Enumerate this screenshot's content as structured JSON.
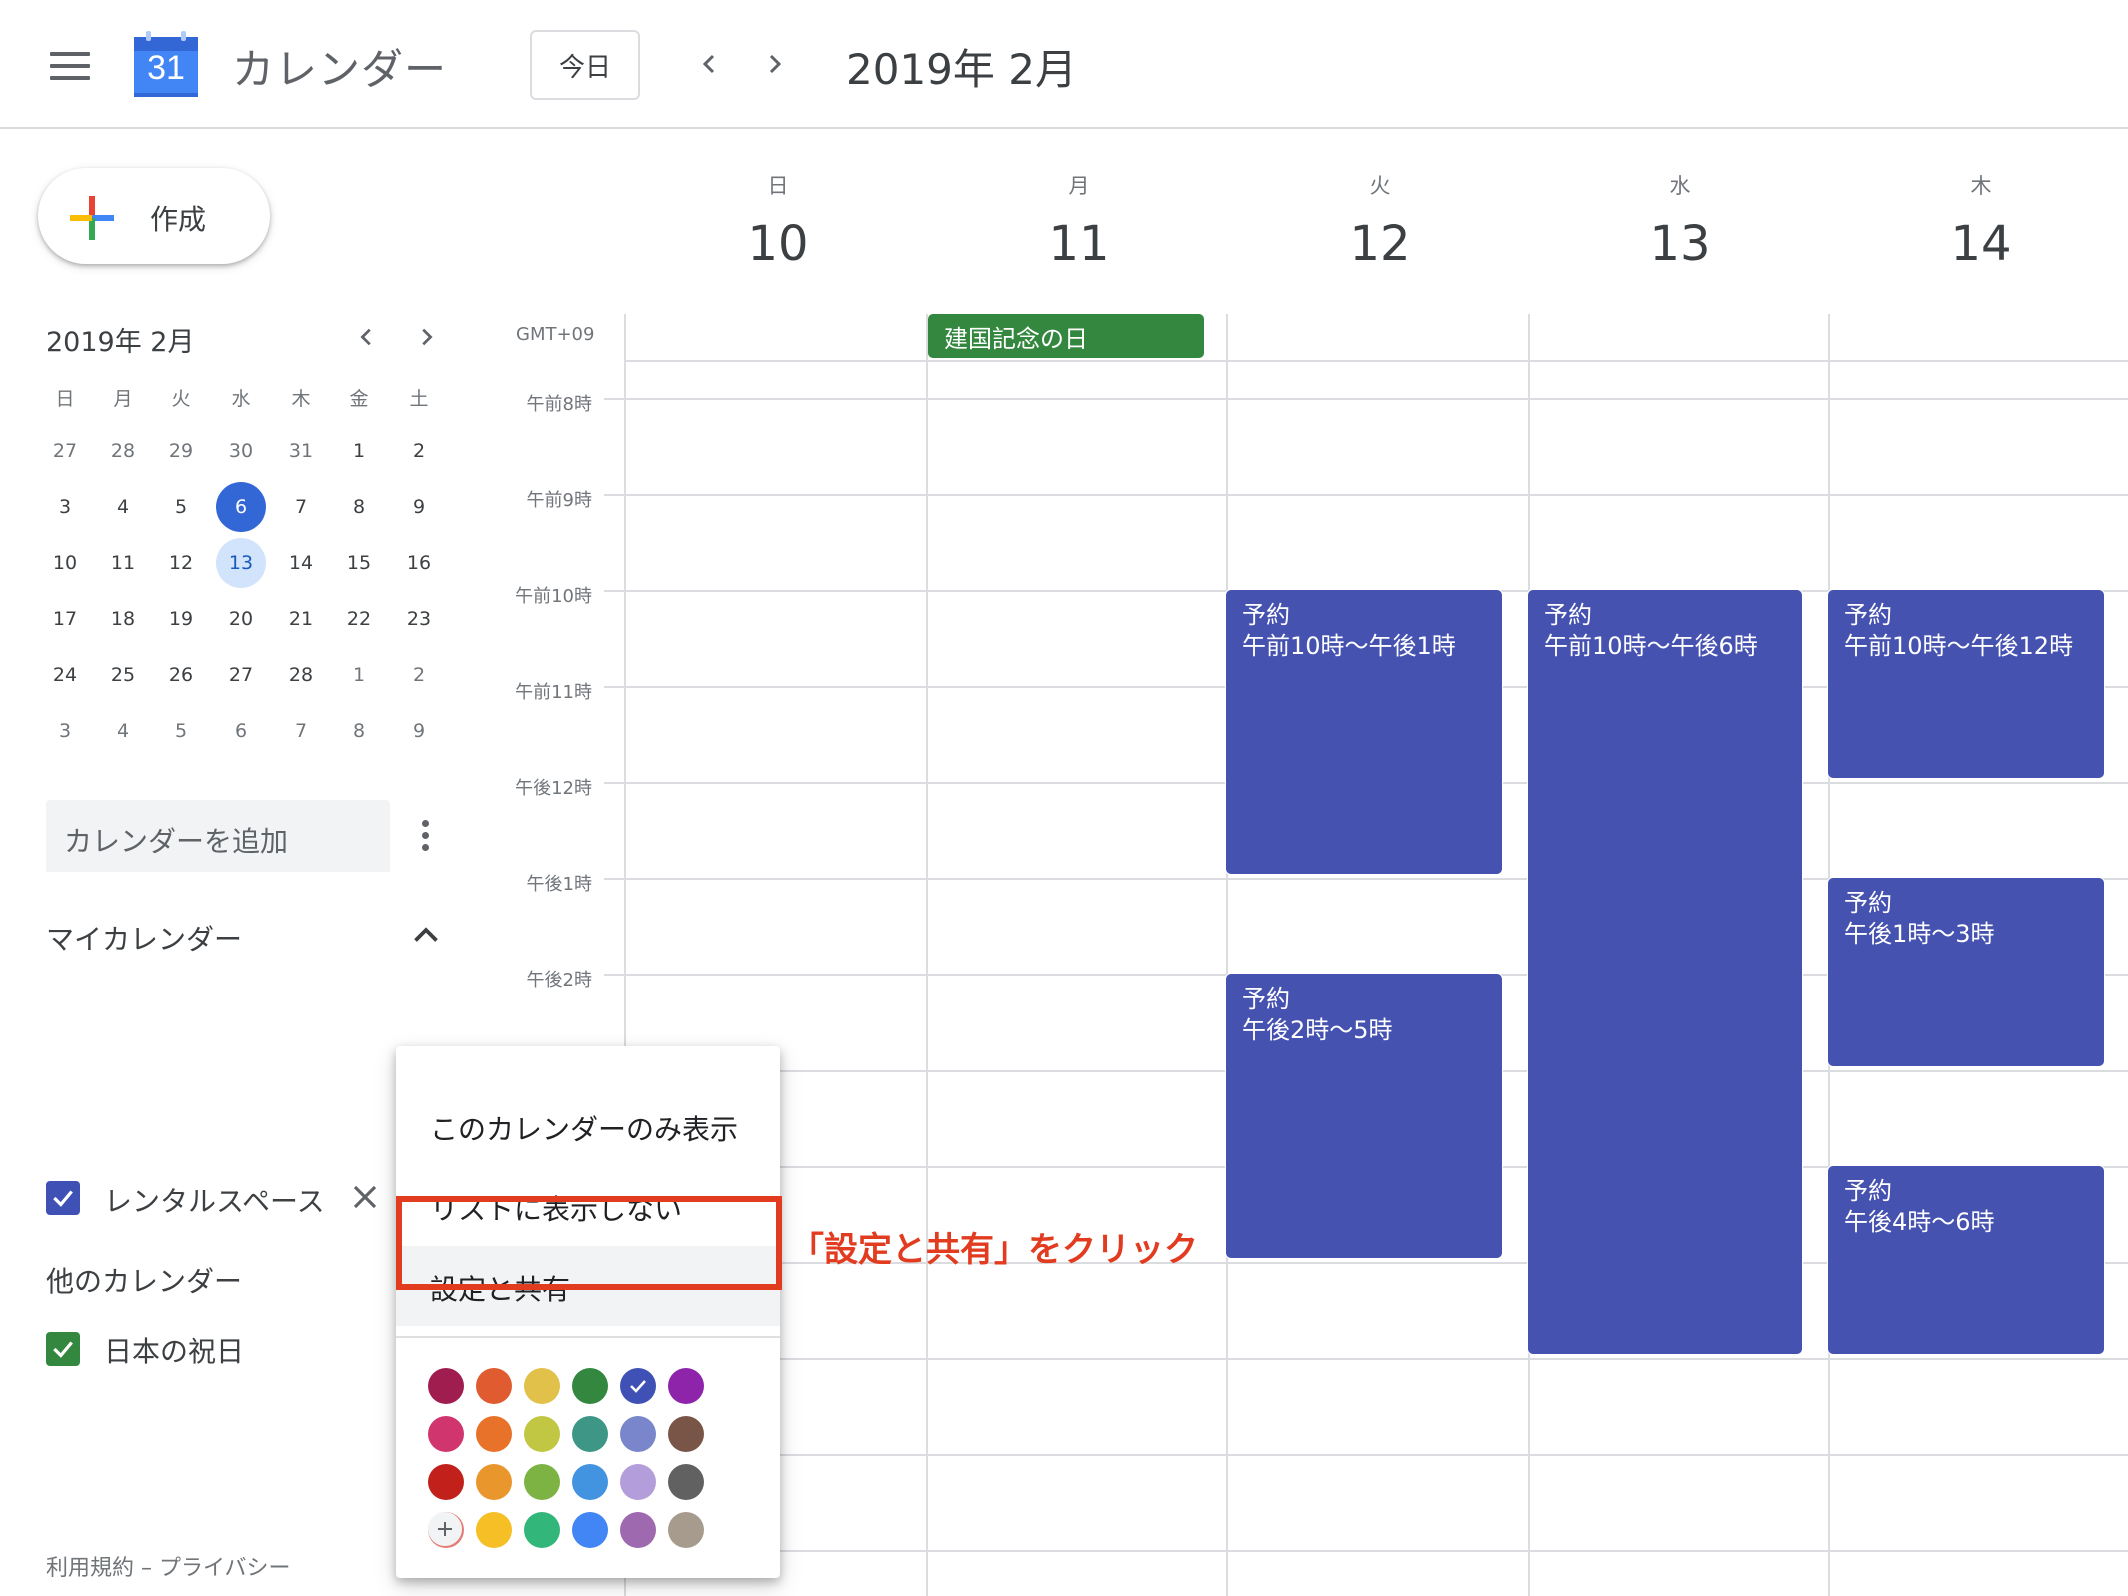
{
  "header": {
    "app_title": "カレンダー",
    "logo_day": "31",
    "today_label": "今日",
    "date_label": "2019年 2月"
  },
  "sidebar": {
    "create_label": "作成",
    "mini_calendar": {
      "title": "2019年 2月",
      "weekdays": [
        "日",
        "月",
        "火",
        "水",
        "木",
        "金",
        "土"
      ],
      "weeks": [
        [
          "27",
          "28",
          "29",
          "30",
          "31",
          "1",
          "2"
        ],
        [
          "3",
          "4",
          "5",
          "6",
          "7",
          "8",
          "9"
        ],
        [
          "10",
          "11",
          "12",
          "13",
          "14",
          "15",
          "16"
        ],
        [
          "17",
          "18",
          "19",
          "20",
          "21",
          "22",
          "23"
        ],
        [
          "24",
          "25",
          "26",
          "27",
          "28",
          "1",
          "2"
        ],
        [
          "3",
          "4",
          "5",
          "6",
          "7",
          "8",
          "9"
        ]
      ],
      "selected_day": "6",
      "current_day": "13"
    },
    "add_calendar_placeholder": "カレンダーを追加",
    "my_calendars_heading": "マイカレンダー",
    "my_calendars": [
      {
        "label": "レンタルスペース",
        "checked": true,
        "color": "#3f51b5"
      }
    ],
    "other_calendars_heading": "他のカレンダー",
    "other_calendars": [
      {
        "label": "日本の祝日",
        "checked": true,
        "color": "#33873e"
      }
    ],
    "footer": "利用規約 – プライバシー"
  },
  "main": {
    "timezone": "GMT+09",
    "days": [
      {
        "name": "日",
        "num": "10"
      },
      {
        "name": "月",
        "num": "11"
      },
      {
        "name": "火",
        "num": "12"
      },
      {
        "name": "水",
        "num": "13"
      },
      {
        "name": "木",
        "num": "14"
      }
    ],
    "all_day_event": "建国記念の日",
    "time_labels": [
      "午前8時",
      "午前9時",
      "午前10時",
      "午前11時",
      "午後12時",
      "午後1時",
      "午後2時"
    ],
    "events": [
      {
        "title": "予約",
        "time": "午前10時～午後1時"
      },
      {
        "title": "予約",
        "time": "午前10時～午後6時"
      },
      {
        "title": "予約",
        "time": "午前10時～午後12時"
      },
      {
        "title": "予約",
        "time": "午後1時～3時"
      },
      {
        "title": "予約",
        "time": "午後2時～5時"
      },
      {
        "title": "予約",
        "time": "午後4時～6時"
      }
    ],
    "event_color": "#4652b0",
    "holiday_color": "#33873e"
  },
  "popup_menu": {
    "items": [
      "このカレンダーのみ表示",
      "リストに表示しない",
      "設定と共有"
    ],
    "colors": [
      [
        "#a01d4f",
        "#e05b2f",
        "#e2c14a",
        "#33873e",
        "#3f51b5",
        "#8e24aa"
      ],
      [
        "#d0366d",
        "#e8722a",
        "#c1c742",
        "#3e9687",
        "#7986cb",
        "#795548"
      ],
      [
        "#c2201a",
        "#e9962d",
        "#7cb342",
        "#4294e0",
        "#b39ddb",
        "#616161"
      ],
      [
        "#e67c73",
        "#f6bf26",
        "#33b679",
        "#4285f4",
        "#9e69af",
        "#a79b8e"
      ]
    ],
    "selected_color": "#3f51b5"
  },
  "annotation": "「設定と共有」をクリック"
}
